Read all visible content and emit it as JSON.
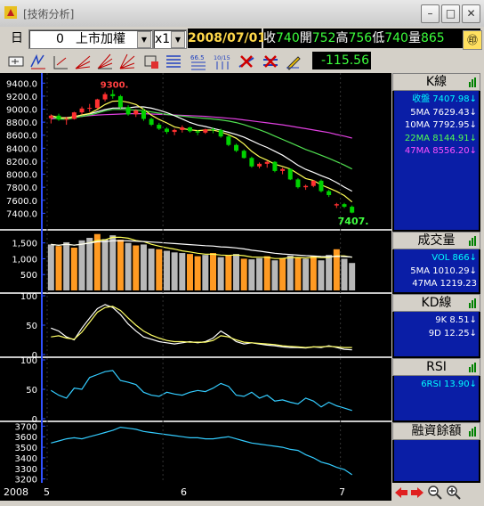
{
  "window": {
    "title": "[技術分析]"
  },
  "toolbar": {
    "period": "日",
    "stock_code": "0",
    "stock_name": "上市加權",
    "multiplier": "x1",
    "date": "2008/07/01",
    "quote": [
      {
        "label": "收",
        "value": "740"
      },
      {
        "label": "開",
        "value": "752"
      },
      {
        "label": "高",
        "value": "756"
      },
      {
        "label": "低",
        "value": "740"
      },
      {
        "label": "量",
        "value": "865"
      }
    ],
    "change": "-115.56",
    "tool_icons": [
      "pointer-icon",
      "cycle-icon",
      "channel-icon",
      "fan-icon",
      "fibonacci-fan-icon",
      "gann-fan-icon",
      "box-icon",
      "parallel-lines-icon",
      "percent-icon",
      "time-ratio-icon",
      "delete-drawing-icon",
      "clear-drawings-icon",
      "pen-icon"
    ],
    "tool_labels": {
      "percent": "66.5",
      "ratio": "10/15"
    }
  },
  "colors": {
    "up": "#ff3030",
    "down": "#00d200",
    "price_line": "#ffffff",
    "ma5": "#ffff55",
    "ma10": "#ffffff",
    "ma22": "#50e050",
    "ma47": "#e040e0",
    "vol_up": "#ff9a22",
    "vol_down": "#b8b8b8",
    "side_bg": "#0a1ea6"
  },
  "chart_data": [
    {
      "type": "candlestick",
      "title": "K線",
      "ylim": [
        7200,
        9500
      ],
      "yticks": [
        "9400.0",
        "9200.0",
        "9000.0",
        "8800.0",
        "8600.0",
        "8400.0",
        "8200.0",
        "8000.0",
        "7800.0",
        "7600.0",
        "7400.0"
      ],
      "high_label": "9300.",
      "last_label": "7407.",
      "ohlc": [
        [
          8860,
          8920,
          8780,
          8900
        ],
        [
          8900,
          8930,
          8820,
          8840
        ],
        [
          8840,
          8880,
          8760,
          8850
        ],
        [
          8850,
          8960,
          8840,
          8950
        ],
        [
          8950,
          9040,
          8920,
          9010
        ],
        [
          9010,
          9080,
          8960,
          9020
        ],
        [
          9020,
          9160,
          9000,
          9150
        ],
        [
          9150,
          9260,
          9120,
          9230
        ],
        [
          9230,
          9300,
          9160,
          9200
        ],
        [
          9200,
          9220,
          9010,
          9030
        ],
        [
          9030,
          9060,
          8900,
          8920
        ],
        [
          8920,
          9000,
          8880,
          8980
        ],
        [
          8980,
          9010,
          8820,
          8850
        ],
        [
          8850,
          8870,
          8740,
          8760
        ],
        [
          8760,
          8790,
          8680,
          8700
        ],
        [
          8700,
          8720,
          8620,
          8650
        ],
        [
          8650,
          8700,
          8600,
          8680
        ],
        [
          8680,
          8750,
          8640,
          8720
        ],
        [
          8720,
          8730,
          8640,
          8660
        ],
        [
          8660,
          8680,
          8600,
          8640
        ],
        [
          8640,
          8700,
          8620,
          8690
        ],
        [
          8690,
          8720,
          8630,
          8680
        ],
        [
          8680,
          8700,
          8560,
          8580
        ],
        [
          8580,
          8600,
          8430,
          8450
        ],
        [
          8450,
          8470,
          8340,
          8360
        ],
        [
          8360,
          8380,
          8240,
          8250
        ],
        [
          8250,
          8270,
          8100,
          8120
        ],
        [
          8120,
          8180,
          8090,
          8160
        ],
        [
          8160,
          8210,
          8100,
          8190
        ],
        [
          8190,
          8200,
          8030,
          8050
        ],
        [
          8050,
          8100,
          8000,
          8080
        ],
        [
          8080,
          8090,
          7910,
          7920
        ],
        [
          7920,
          7940,
          7780,
          7800
        ],
        [
          7800,
          7840,
          7760,
          7820
        ],
        [
          7820,
          7910,
          7800,
          7900
        ],
        [
          7900,
          7920,
          7720,
          7740
        ],
        [
          7740,
          7760,
          7650,
          7680
        ],
        [
          7520,
          7560,
          7480,
          7540
        ],
        [
          7540,
          7560,
          7480,
          7500
        ],
        [
          7500,
          7520,
          7400,
          7410
        ]
      ],
      "ma_labels": [
        {
          "name": "收盤",
          "value": "7407.98",
          "arrow": "↓",
          "color": "#00ffff"
        },
        {
          "name": "5MA",
          "value": "7629.43",
          "arrow": "↓",
          "color": "#ffffff"
        },
        {
          "name": "10MA",
          "value": "7792.95",
          "arrow": "↓",
          "color": "#ffffff"
        },
        {
          "name": "22MA",
          "value": "8144.91",
          "arrow": "↓",
          "color": "#50ff50"
        },
        {
          "name": "47MA",
          "value": "8556.20",
          "arrow": "↓",
          "color": "#ff50ff"
        }
      ],
      "ma47": [
        8850,
        8860,
        8870,
        8880,
        8890,
        8900,
        8910,
        8915,
        8920,
        8925,
        8930,
        8930,
        8930,
        8925,
        8920,
        8915,
        8910,
        8905,
        8900,
        8895,
        8890,
        8880,
        8870,
        8860,
        8850,
        8835,
        8820,
        8805,
        8790,
        8775,
        8760,
        8740,
        8720,
        8700,
        8680,
        8660,
        8640,
        8610,
        8585,
        8556
      ]
    },
    {
      "type": "bar",
      "title": "成交量",
      "ylim": [
        0,
        1800
      ],
      "yticks": [
        "1,500",
        "1,000",
        "500"
      ],
      "values": [
        1450,
        1400,
        1520,
        1350,
        1580,
        1660,
        1780,
        1620,
        1740,
        1600,
        1500,
        1420,
        1450,
        1320,
        1300,
        1250,
        1200,
        1180,
        1150,
        1080,
        1120,
        1180,
        1050,
        1100,
        1150,
        1000,
        980,
        1020,
        1080,
        950,
        1020,
        1100,
        1050,
        1000,
        1080,
        950,
        1120,
        1300,
        1000,
        866
      ],
      "up": [
        false,
        true,
        false,
        true,
        false,
        false,
        true,
        false,
        false,
        true,
        false,
        true,
        false,
        false,
        true,
        false,
        false,
        false,
        true,
        true,
        false,
        true,
        false,
        true,
        false,
        true,
        false,
        false,
        true,
        false,
        true,
        false,
        true,
        false,
        true,
        false,
        false,
        true,
        false,
        false
      ],
      "labels": [
        {
          "name": "VOL",
          "value": "866",
          "arrow": "↓",
          "color": "#00ffff"
        },
        {
          "name": "5MA",
          "value": "1010.29",
          "arrow": "↓",
          "color": "#ffffff"
        },
        {
          "name": "47MA",
          "value": "1219.23",
          "arrow": "",
          "color": "#ffffff"
        }
      ]
    },
    {
      "type": "line",
      "title": "KD線",
      "ylim": [
        0,
        100
      ],
      "yticks": [
        "100",
        "50",
        "0"
      ],
      "series": [
        {
          "name": "9K",
          "values": [
            45,
            40,
            30,
            25,
            45,
            62,
            78,
            85,
            80,
            68,
            52,
            40,
            30,
            26,
            22,
            20,
            18,
            20,
            22,
            20,
            22,
            28,
            40,
            32,
            22,
            18,
            20,
            18,
            16,
            15,
            13,
            12,
            12,
            11,
            13,
            12,
            15,
            12,
            9,
            8
          ]
        },
        {
          "name": "9D",
          "values": [
            30,
            32,
            28,
            26,
            38,
            55,
            72,
            80,
            82,
            75,
            62,
            50,
            40,
            33,
            28,
            24,
            22,
            22,
            21,
            21,
            21,
            24,
            32,
            30,
            25,
            21,
            20,
            19,
            18,
            17,
            15,
            14,
            13,
            12,
            13,
            13,
            14,
            13,
            12,
            12
          ]
        }
      ],
      "labels": [
        {
          "name": "9K",
          "value": "8.51",
          "arrow": "↓",
          "color": "#ffffff"
        },
        {
          "name": "9D",
          "value": "12.25",
          "arrow": "↓",
          "color": "#ffffff"
        }
      ]
    },
    {
      "type": "line",
      "title": "RSI",
      "ylim": [
        0,
        100
      ],
      "yticks": [
        "100",
        "50",
        "0"
      ],
      "series": [
        {
          "name": "6RSI",
          "values": [
            48,
            40,
            35,
            52,
            50,
            70,
            75,
            80,
            82,
            65,
            62,
            58,
            45,
            40,
            38,
            45,
            42,
            40,
            45,
            48,
            46,
            52,
            60,
            55,
            40,
            38,
            45,
            35,
            40,
            30,
            32,
            28,
            25,
            35,
            30,
            20,
            28,
            22,
            18,
            14
          ]
        }
      ],
      "labels": [
        {
          "name": "6RSI",
          "value": "13.90",
          "arrow": "↓",
          "color": "#00ffff"
        }
      ]
    },
    {
      "type": "line",
      "title": "融資餘額",
      "ylim": [
        3180,
        3720
      ],
      "yticks": [
        "3700",
        "3600",
        "3500",
        "3400",
        "3300",
        "3200"
      ],
      "series": [
        {
          "name": "融資餘額",
          "values": [
            3540,
            3560,
            3580,
            3590,
            3580,
            3600,
            3620,
            3640,
            3660,
            3690,
            3680,
            3670,
            3650,
            3640,
            3630,
            3620,
            3610,
            3600,
            3590,
            3590,
            3580,
            3580,
            3590,
            3600,
            3580,
            3560,
            3540,
            3530,
            3520,
            3510,
            3500,
            3480,
            3470,
            3430,
            3400,
            3360,
            3340,
            3310,
            3290,
            3240
          ]
        }
      ],
      "labels": []
    }
  ],
  "x_axis": {
    "year": "2008",
    "months": [
      "5",
      "6",
      "7"
    ]
  },
  "side": {
    "ma_values": [
      "7407.98",
      "7629.43",
      "7792.95",
      "8144.91",
      "8556.20"
    ]
  }
}
